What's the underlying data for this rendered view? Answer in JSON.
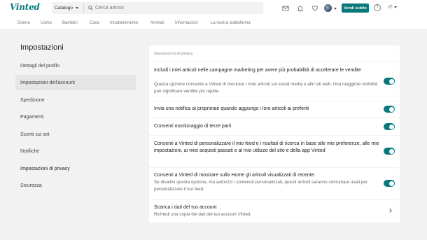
{
  "header": {
    "logo": "Vinted",
    "catalog_label": "Catalogo",
    "search_placeholder": "Cerca articoli",
    "sell_button": "Vendi subito",
    "help_label": "?",
    "language": "IT"
  },
  "nav": {
    "items": [
      "Donna",
      "Uomo",
      "Bambini",
      "Casa",
      "Intrattenimento",
      "Animali",
      "Informazioni",
      "La nostra piattaforma"
    ]
  },
  "sidebar": {
    "title": "Impostazioni",
    "items": [
      {
        "label": "Dettagli del profilo"
      },
      {
        "label": "Impostazioni dell'account"
      },
      {
        "label": "Spedizione"
      },
      {
        "label": "Pagamenti"
      },
      {
        "label": "Sconti sui set"
      },
      {
        "label": "Notifiche"
      },
      {
        "label": "Impostazioni di privacy"
      },
      {
        "label": "Sicurezza"
      }
    ]
  },
  "privacy": {
    "section_title": "Impostazioni di privacy",
    "rows": [
      {
        "title": "Includi i miei articoli nelle campagne marketing per avere più probabilità di accelerare le vendite",
        "description": "Questa opzione consente a Vinted di mostrare i miei articoli sui social media e altri siti web. Una maggiore visibilità può significare vendite più rapide.",
        "enabled": true
      },
      {
        "title": "Invia una notifica ai proprietari quando aggiungo i loro articoli ai preferiti",
        "enabled": true
      },
      {
        "title": "Consenti monitoraggio di terze parti",
        "enabled": true
      },
      {
        "title": "Consenti a Vinted di personalizzare il mio feed e i risultati di ricerca in base alle mie preferenze, alle mie impostazioni, ai miei acquisti passati e al mio utilizzo del sito e della app Vinted",
        "enabled": true
      },
      {
        "title": "Consenti a Vinted di mostrare sulla Home gli articoli visualizzati di recente.",
        "description": "Se disattivi questa opzione, ma autorizzi i contenuti personalizzati, questi articoli saranno comunque usati per personalizzare il tuo feed.",
        "enabled": true
      },
      {
        "title": "Scarica i dati del tuo account",
        "description": "Richiedi una copia dei dati del tuo account Vinted."
      }
    ]
  },
  "colors": {
    "brand": "#09787a",
    "page_bg": "#f2f2f2"
  }
}
